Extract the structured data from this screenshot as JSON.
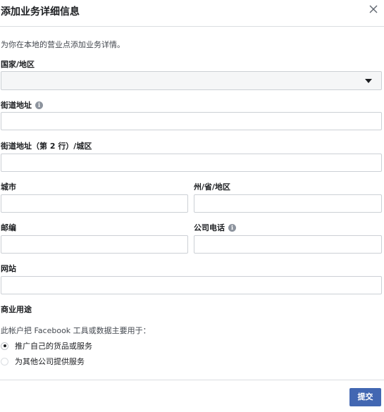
{
  "dialog": {
    "title": "添加业务详细信息",
    "intro": "为你在本地的营业点添加业务详情。"
  },
  "fields": {
    "country": {
      "label": "国家/地区",
      "value": ""
    },
    "street": {
      "label": "街道地址",
      "value": ""
    },
    "street2": {
      "label": "街道地址（第 2 行）/城区",
      "value": ""
    },
    "city": {
      "label": "城市",
      "value": ""
    },
    "state": {
      "label": "州/省/地区",
      "value": ""
    },
    "zip": {
      "label": "邮编",
      "value": ""
    },
    "phone": {
      "label": "公司电话",
      "value": ""
    },
    "website": {
      "label": "网站",
      "value": ""
    }
  },
  "business_use": {
    "heading": "商业用途",
    "question": "此帐户把 Facebook 工具或数据主要用于：",
    "options": [
      {
        "label": "推广自己的货品或服务",
        "selected": true
      },
      {
        "label": "为其他公司提供服务",
        "selected": false
      }
    ]
  },
  "footer": {
    "submit_label": "提交"
  },
  "colors": {
    "primary_button": "#4267b2",
    "border": "#ccd0d5",
    "select_bg": "#f5f6f7"
  }
}
